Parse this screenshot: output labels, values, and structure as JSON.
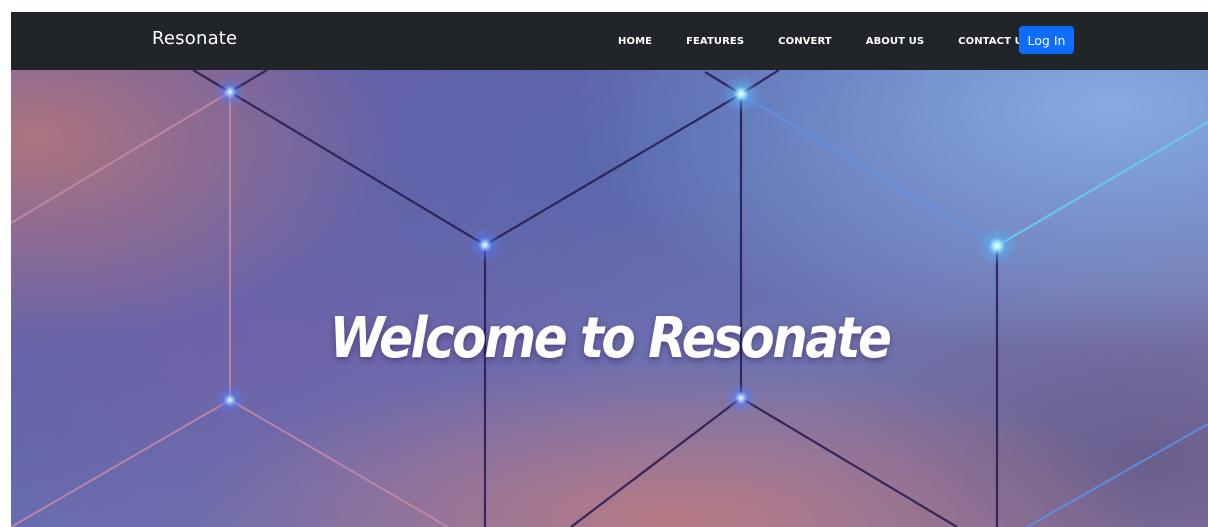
{
  "navbar": {
    "brand": "Resonate",
    "links": [
      "HOME",
      "FEATURES",
      "CONVERT",
      "ABOUT US",
      "CONTACT US"
    ],
    "login_label": "Log In"
  },
  "hero": {
    "title": "Welcome to Resonate",
    "background_icon": "hexagon-network-background"
  },
  "colors": {
    "navbar_bg": "#212529",
    "login_button": "#0d6efd",
    "hero_text": "#ffffff"
  }
}
